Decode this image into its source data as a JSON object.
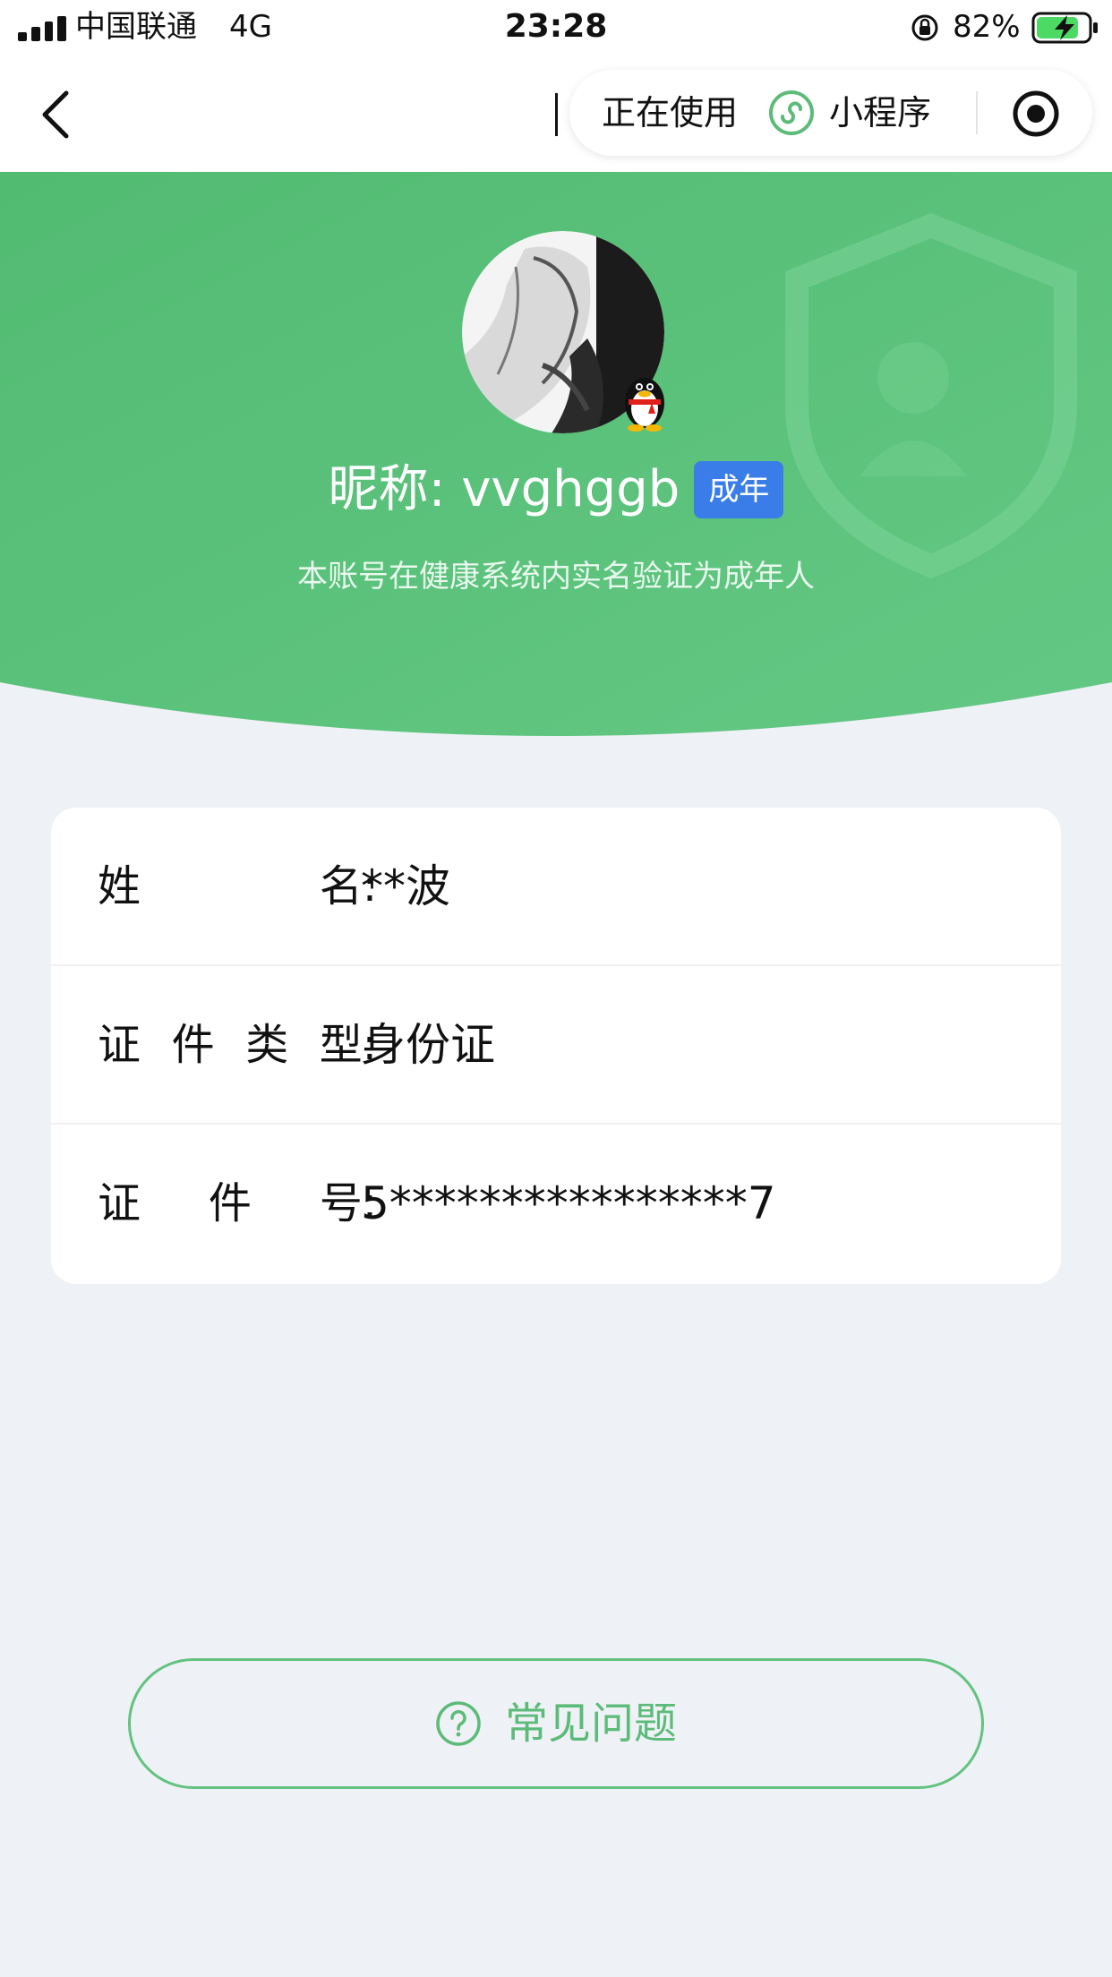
{
  "status_bar": {
    "carrier": "中国联通",
    "network": "4G",
    "time": "23:28",
    "battery": "82%",
    "battery_level": 0.82
  },
  "nav": {
    "capsule_text": "正在使用",
    "capsule_app": "小程序",
    "icons": [
      "back-icon",
      "miniapp-icon",
      "target-icon"
    ]
  },
  "profile": {
    "nickname": "昵称: vvghggb",
    "badge": "成年",
    "subtitle": "本账号在健康系统内实名验证为成年人"
  },
  "info": {
    "rows": [
      {
        "label": [
          "姓",
          "名:"
        ],
        "value": "**波"
      },
      {
        "label": [
          "证",
          "件",
          "类",
          "型:"
        ],
        "value": "身份证"
      },
      {
        "label": [
          "证",
          "件",
          "号:"
        ],
        "value": "5****************7"
      }
    ]
  },
  "faq": {
    "label": "常见问题"
  },
  "colors": {
    "header_green": "#5cc27a",
    "accent_green": "#5dbb79",
    "badge_blue": "#3b7de8",
    "page_bg": "#eef1f6"
  }
}
